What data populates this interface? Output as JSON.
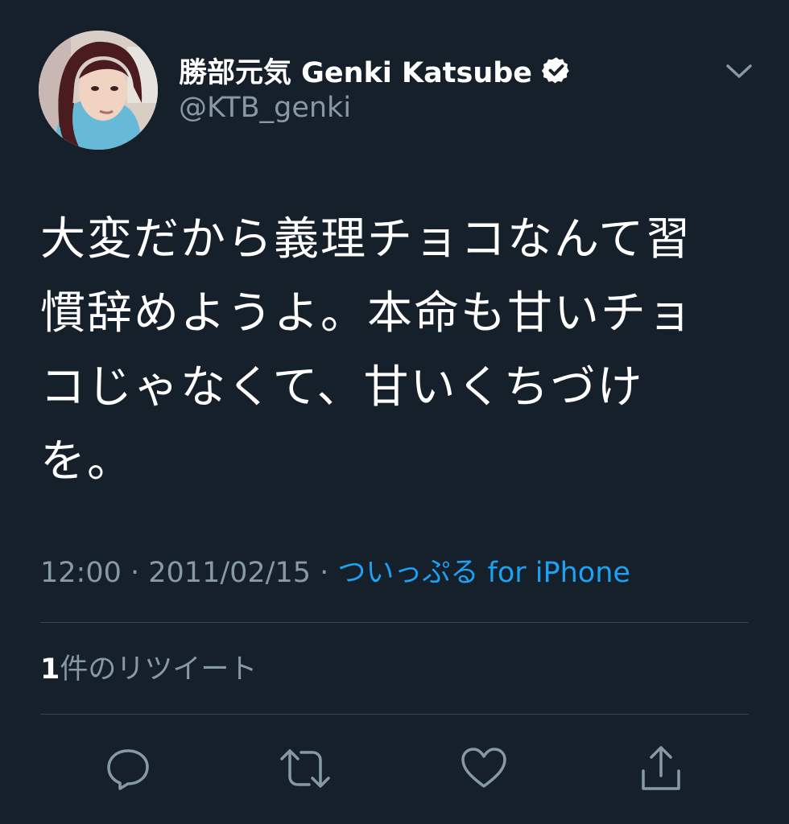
{
  "user": {
    "display_name": "勝部元気 Genki Katsube",
    "handle": "@KTB_genki",
    "verified": true
  },
  "tweet": {
    "text": "大変だから義理チョコなんて習慣辞めようよ。本命も甘いチョコじゃなくて、甘いくちづけを。",
    "time": "12:00",
    "date": "2011/02/15",
    "separator": " · ",
    "source": "ついっぷる for iPhone"
  },
  "stats": {
    "retweet_count": "1",
    "retweet_label": "件のリツイート"
  },
  "actions": [
    {
      "icon": "reply-icon"
    },
    {
      "icon": "retweet-icon"
    },
    {
      "icon": "like-icon"
    },
    {
      "icon": "share-icon"
    }
  ],
  "colors": {
    "background": "#15202b",
    "text_primary": "#ffffff",
    "text_secondary": "#8899a6",
    "link": "#1da1f2",
    "divider": "#38444d"
  }
}
